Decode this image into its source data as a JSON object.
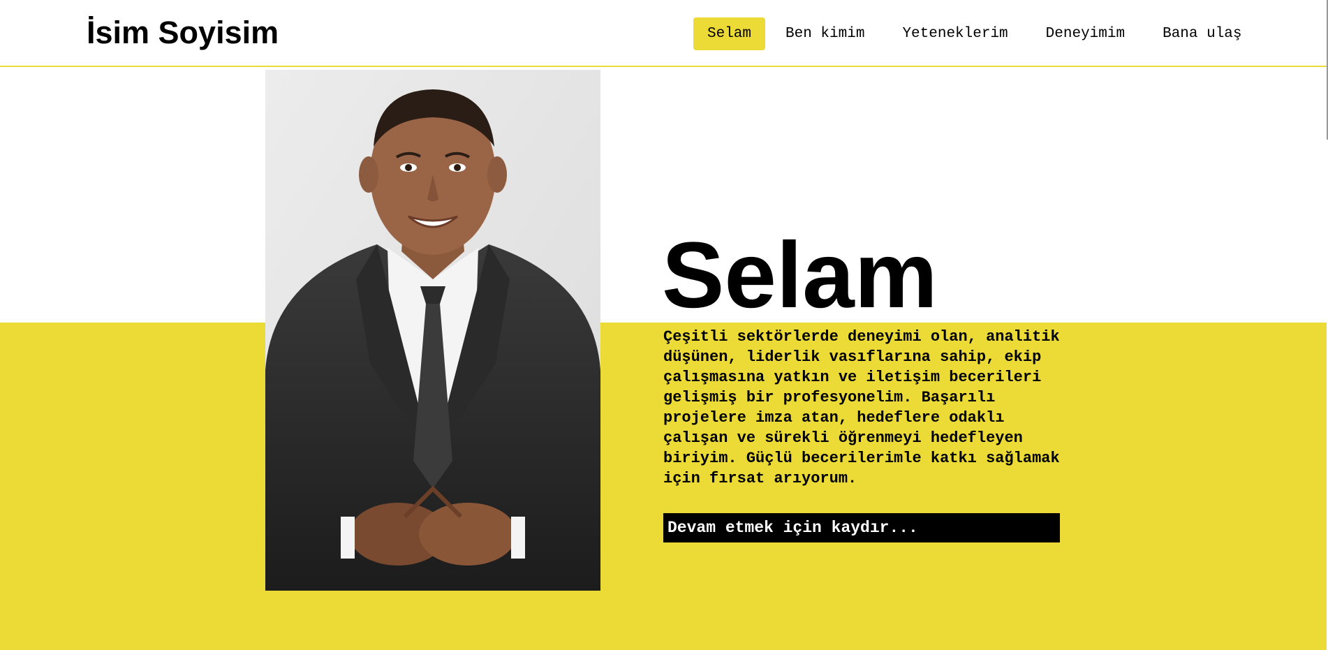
{
  "header": {
    "brand": "İsim Soyisim",
    "nav": [
      {
        "label": "Selam",
        "active": true
      },
      {
        "label": "Ben kimim",
        "active": false
      },
      {
        "label": "Yeteneklerim",
        "active": false
      },
      {
        "label": "Deneyimim",
        "active": false
      },
      {
        "label": "Bana ulaş",
        "active": false
      }
    ]
  },
  "hero": {
    "title": "Selam",
    "text": "Çeşitli sektörlerde deneyimi olan, analitik düşünen, liderlik vasıflarına sahip, ekip çalışmasına yatkın ve iletişim becerileri gelişmiş bir profesyonelim. Başarılı projelere imza atan, hedeflere odaklı çalışan ve sürekli öğrenmeyi hedefleyen biriyim. Güçlü becerilerimle katkı sağlamak için fırsat arıyorum.",
    "scroll_hint": "Devam etmek için kaydır...",
    "photo_icon": "person-photo"
  },
  "colors": {
    "accent": "#ecdb37",
    "background": "#ffffff",
    "text": "#000000"
  }
}
